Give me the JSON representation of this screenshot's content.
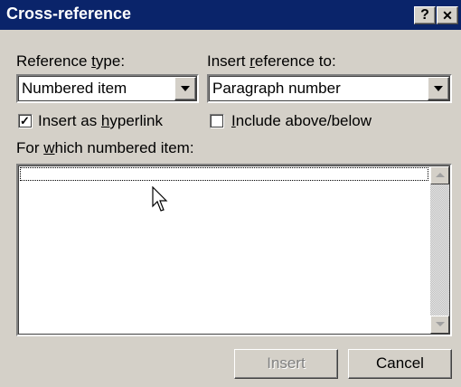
{
  "dialog": {
    "title": "Cross-reference",
    "help_button": "?",
    "close_button": "✕"
  },
  "reference_type": {
    "label_pre": "Reference ",
    "label_accel": "t",
    "label_post": "ype:",
    "value": "Numbered item"
  },
  "insert_reference_to": {
    "label_pre": "Insert ",
    "label_accel": "r",
    "label_post": "eference to:",
    "value": "Paragraph number"
  },
  "insert_as_hyperlink": {
    "label_pre": "Insert as ",
    "label_accel": "h",
    "label_post": "yperlink",
    "checked": true
  },
  "include_above_below": {
    "label_pre": "",
    "label_accel": "I",
    "label_post": "nclude above/below",
    "checked": false
  },
  "which_item": {
    "label_pre": "For ",
    "label_accel": "w",
    "label_post": "hich numbered item:",
    "items": []
  },
  "buttons": {
    "insert": "Insert",
    "cancel": "Cancel"
  },
  "colors": {
    "title_bar": "#0a246a",
    "face": "#d4d0c8"
  }
}
